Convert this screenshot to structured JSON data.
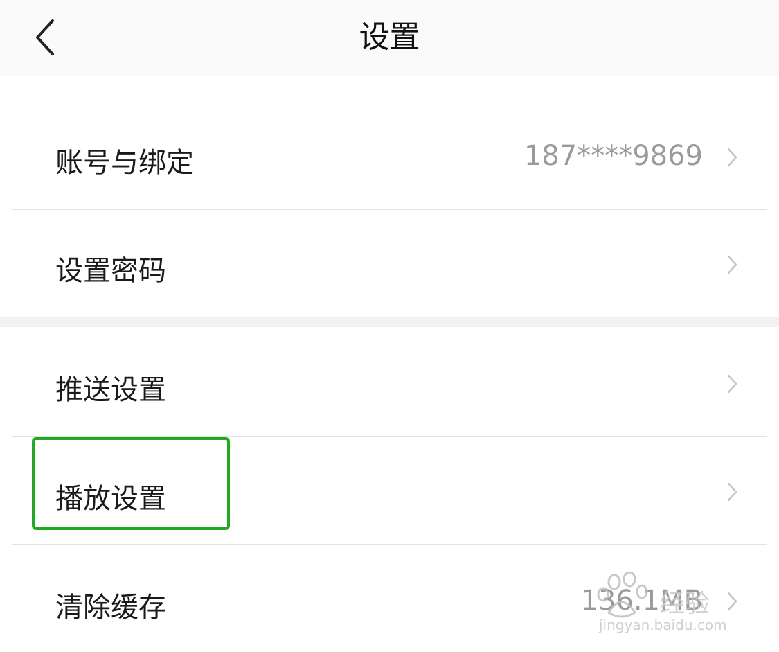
{
  "header": {
    "title": "设置",
    "back_icon": "chevron-left-icon"
  },
  "items": [
    {
      "label": "账号与绑定",
      "value": "187****9869",
      "icon": "chevron-right-icon"
    },
    {
      "label": "设置密码",
      "value": "",
      "icon": "chevron-right-icon"
    },
    {
      "label": "推送设置",
      "value": "",
      "icon": "chevron-right-icon"
    },
    {
      "label": "播放设置",
      "value": "",
      "icon": "chevron-right-icon"
    },
    {
      "label": "清除缓存",
      "value": "136.1MB",
      "icon": "chevron-right-icon"
    }
  ],
  "watermark": {
    "name": "经验",
    "url": "jingyan.baidu.com"
  },
  "colors": {
    "highlight": "#22a822",
    "section_gap": "#f2f2f2",
    "divider": "#e3e3e3",
    "secondary_text": "#9a9a9a"
  }
}
